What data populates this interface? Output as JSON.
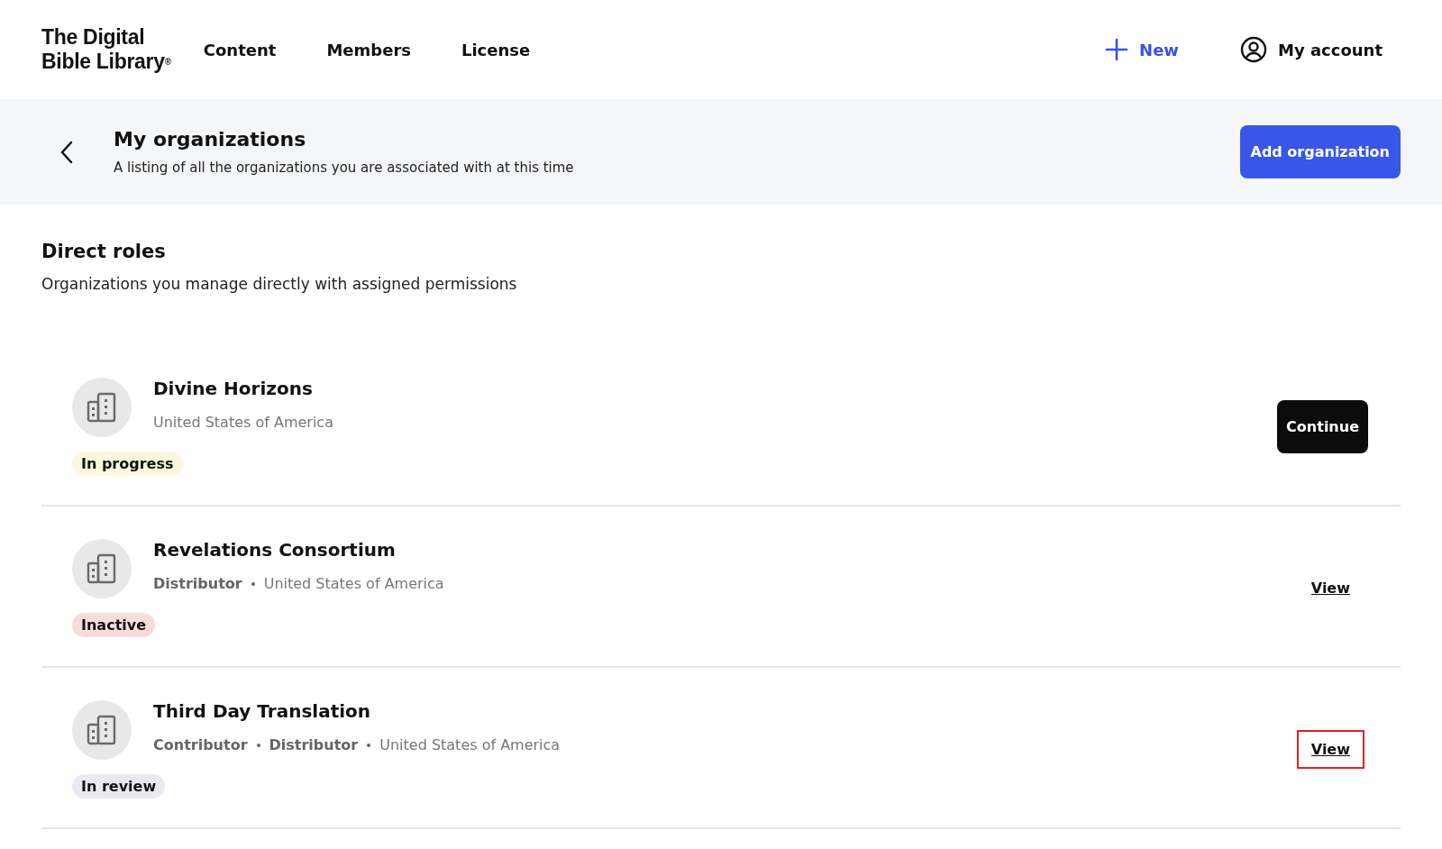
{
  "header": {
    "logo_line_1": "The Digital",
    "logo_line_2": "Bible Library",
    "logo_mark": "®",
    "nav": [
      "Content",
      "Members",
      "License"
    ],
    "new_label": "New",
    "account_label": "My account"
  },
  "banner": {
    "title": "My organizations",
    "subtitle": "A listing of all the organizations you are associated with at this time",
    "button": "Add organization"
  },
  "section": {
    "title": "Direct roles",
    "subtitle": "Organizations you manage directly with assigned permissions"
  },
  "organizations": [
    {
      "name": "Divine Horizons",
      "country": "United States of America",
      "status": "In progress",
      "color": "#fcf8dc",
      "action": {
        "kind": "button",
        "label": "Continue"
      }
    },
    {
      "name": "Revelations Consortium",
      "roles": [
        "Distributor"
      ],
      "country": "United States of America",
      "status": "Inactive",
      "color": "#f8dcdc",
      "action": {
        "kind": "link",
        "label": "View",
        "highlighted": false
      }
    },
    {
      "name": "Third Day Translation",
      "roles": [
        "Contributor",
        "Distributor"
      ],
      "country": "United States of America",
      "status": "In review",
      "color": "#ebe8f4",
      "action": {
        "kind": "link",
        "label": "View",
        "highlighted": true
      }
    }
  ]
}
